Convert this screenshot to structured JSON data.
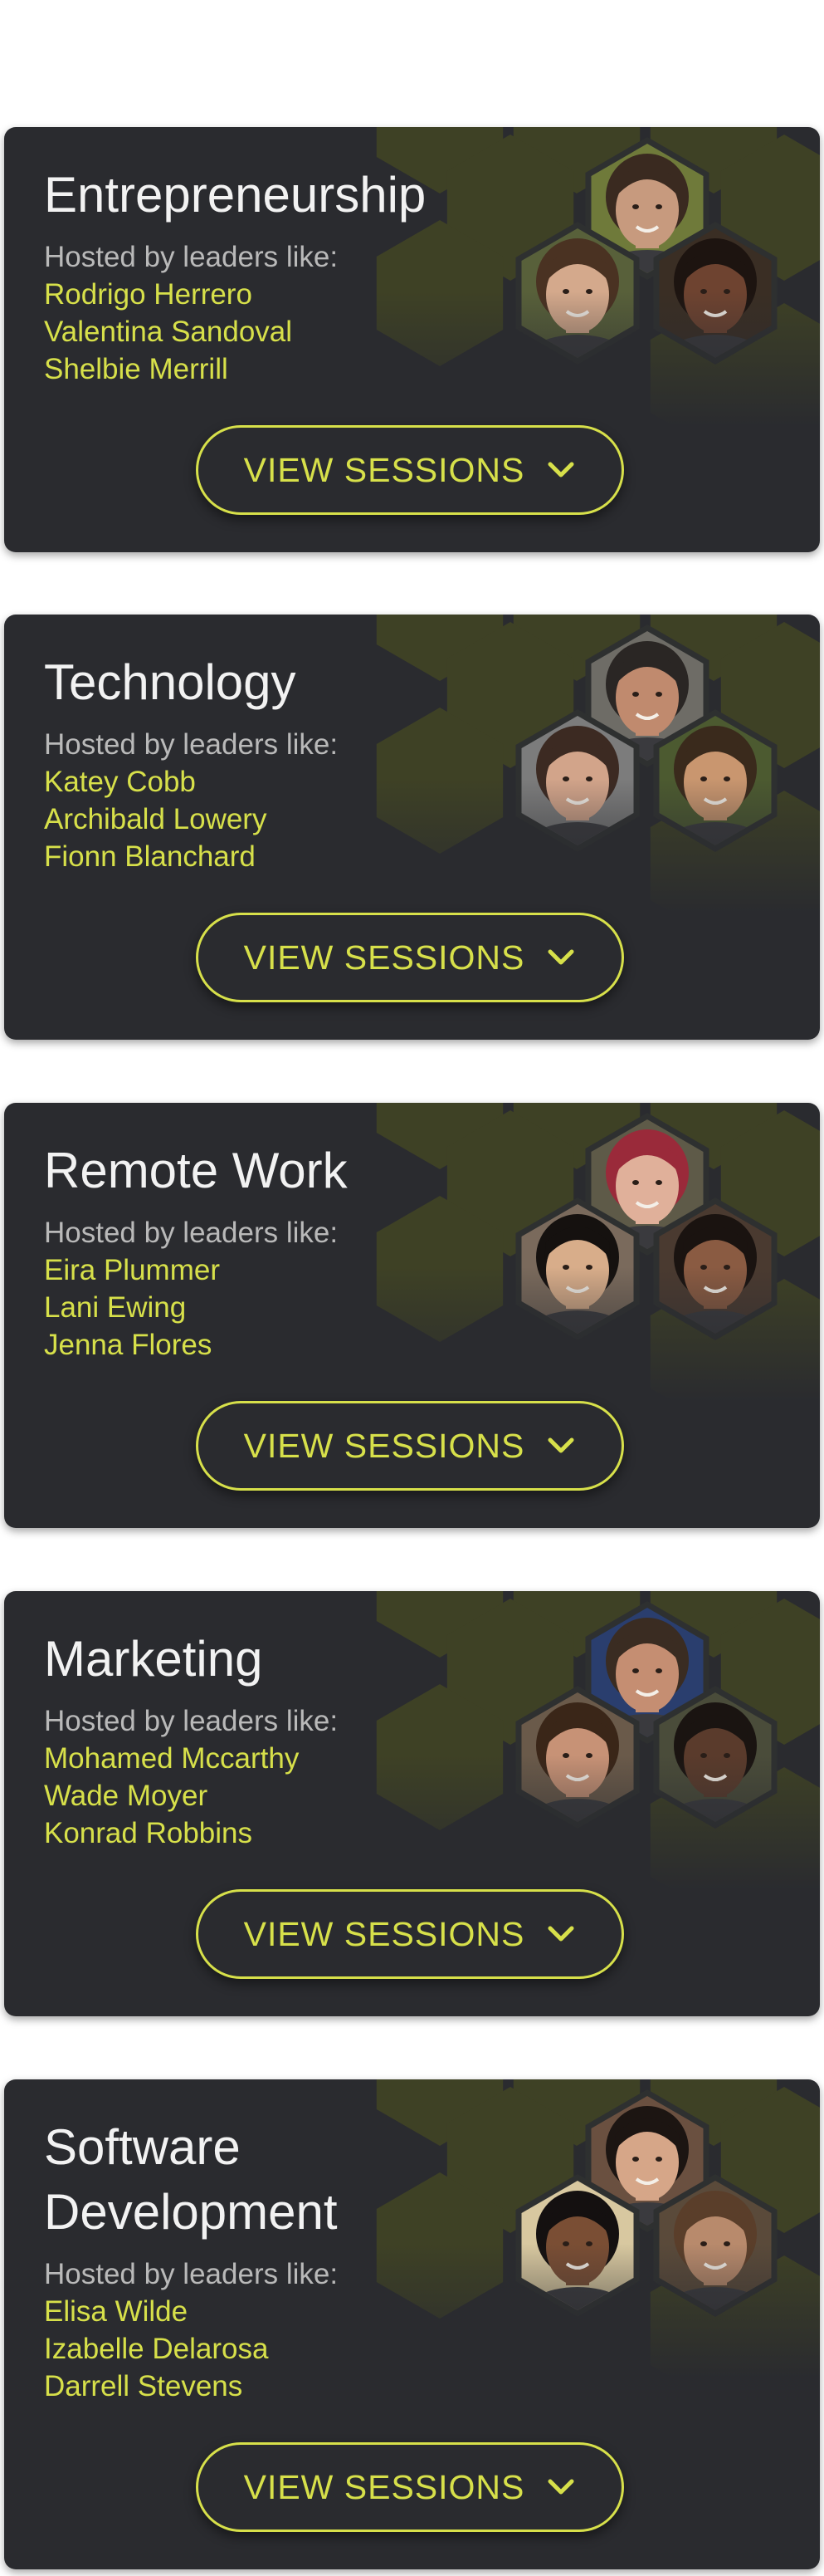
{
  "colors": {
    "card_bg": "#2a2b2f",
    "accent": "#d7e04a",
    "hex_olive": "#3e4125",
    "hosted_text": "#b9b9b9",
    "title_text": "#f2f2f2"
  },
  "cards": [
    {
      "title": "Entrepreneurship",
      "hosted_label": "Hosted by leaders like:",
      "leaders": [
        "Rodrigo Herrero",
        "Valentina Sandoval",
        "Shelbie Merrill"
      ],
      "button_label": "VIEW SESSIONS",
      "button_icon": "chevron-down-icon",
      "portraits": [
        {
          "skin": "#c79a7e",
          "hair": "#3a2a20",
          "bg": "#6f7a3a"
        },
        {
          "skin": "#d4a98c",
          "hair": "#4a3222",
          "bg": "#58603a"
        },
        {
          "skin": "#6e4330",
          "hair": "#1d1410",
          "bg": "#3a2e24"
        }
      ]
    },
    {
      "title": "Technology",
      "hosted_label": "Hosted by leaders like:",
      "leaders": [
        "Katey Cobb",
        "Archibald Lowery",
        "Fionn Blanchard"
      ],
      "button_label": "VIEW SESSIONS",
      "button_icon": "chevron-down-icon",
      "portraits": [
        {
          "skin": "#c08a6e",
          "hair": "#2a2624",
          "bg": "#6e6c66"
        },
        {
          "skin": "#d2a48a",
          "hair": "#3c2a22",
          "bg": "#7c7c7c"
        },
        {
          "skin": "#c9966f",
          "hair": "#3a2a1c",
          "bg": "#4c5a30"
        }
      ]
    },
    {
      "title": "Remote Work",
      "hosted_label": "Hosted by leaders like:",
      "leaders": [
        "Eira Plummer",
        "Lani Ewing",
        "Jenna Flores"
      ],
      "button_label": "VIEW SESSIONS",
      "button_icon": "chevron-down-icon",
      "portraits": [
        {
          "skin": "#e0b09a",
          "hair": "#9a2a3a",
          "bg": "#5e5a48"
        },
        {
          "skin": "#d8ad8a",
          "hair": "#15110f",
          "bg": "#7a6a5c"
        },
        {
          "skin": "#8a5b42",
          "hair": "#1a1310",
          "bg": "#4a3a30"
        }
      ]
    },
    {
      "title": "Marketing",
      "hosted_label": "Hosted by leaders like:",
      "leaders": [
        "Mohamed Mccarthy",
        "Wade Moyer",
        "Konrad Robbins"
      ],
      "button_label": "VIEW SESSIONS",
      "button_icon": "chevron-down-icon",
      "portraits": [
        {
          "skin": "#c58e72",
          "hair": "#3a2c22",
          "bg": "#2a3e6e"
        },
        {
          "skin": "#c79276",
          "hair": "#3a2618",
          "bg": "#6a5a4a"
        },
        {
          "skin": "#5a3b2c",
          "hair": "#1a1411",
          "bg": "#4a4c3a"
        }
      ]
    },
    {
      "title": "Software Development",
      "hosted_label": "Hosted by leaders like:",
      "leaders": [
        "Elisa Wilde",
        "Izabelle Delarosa",
        "Darrell Stevens"
      ],
      "button_label": "VIEW SESSIONS",
      "button_icon": "chevron-down-icon",
      "portraits": [
        {
          "skin": "#d6a688",
          "hair": "#1c1512",
          "bg": "#6a5040"
        },
        {
          "skin": "#7a4e34",
          "hair": "#141010",
          "bg": "#d8c8a0"
        },
        {
          "skin": "#b88a6c",
          "hair": "#5a3e2a",
          "bg": "#5a4a3a"
        }
      ]
    }
  ]
}
